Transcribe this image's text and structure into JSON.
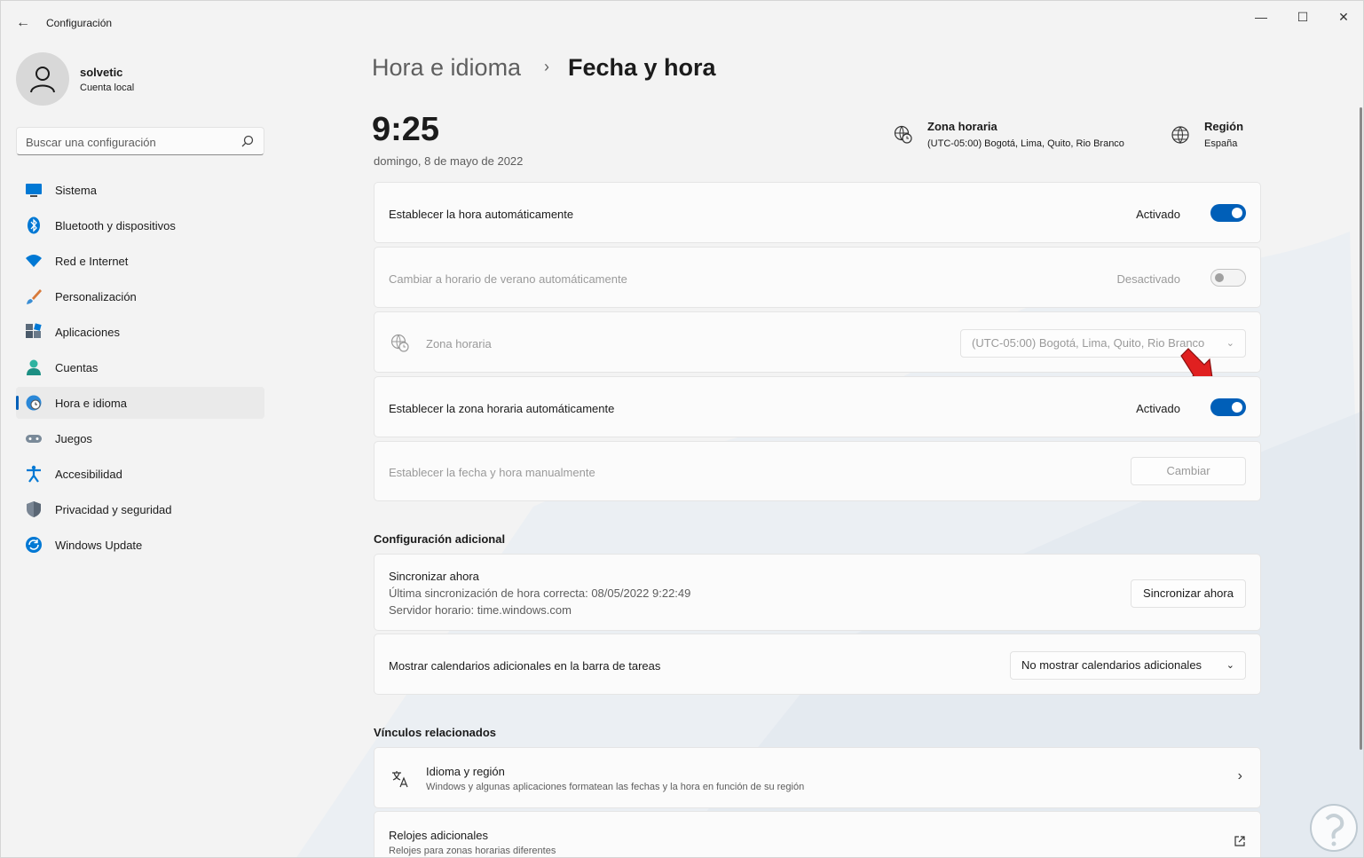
{
  "window": {
    "title": "Configuración",
    "back": "←",
    "minimize": "—",
    "maximize": "☐",
    "close": "✕"
  },
  "user": {
    "name": "solvetic",
    "type": "Cuenta local"
  },
  "search": {
    "placeholder": "Buscar una configuración"
  },
  "nav": [
    {
      "label": "Sistema",
      "icon": "monitor-icon"
    },
    {
      "label": "Bluetooth y dispositivos",
      "icon": "bluetooth-icon"
    },
    {
      "label": "Red e Internet",
      "icon": "wifi-icon"
    },
    {
      "label": "Personalización",
      "icon": "brush-icon"
    },
    {
      "label": "Aplicaciones",
      "icon": "apps-icon"
    },
    {
      "label": "Cuentas",
      "icon": "person-icon"
    },
    {
      "label": "Hora e idioma",
      "icon": "clock-globe-icon",
      "active": true
    },
    {
      "label": "Juegos",
      "icon": "gamepad-icon"
    },
    {
      "label": "Accesibilidad",
      "icon": "accessibility-icon"
    },
    {
      "label": "Privacidad y seguridad",
      "icon": "shield-icon"
    },
    {
      "label": "Windows Update",
      "icon": "update-icon"
    }
  ],
  "breadcrumb": {
    "parent": "Hora e idioma",
    "separator": "›",
    "current": "Fecha y hora"
  },
  "clock": {
    "time": "9:25",
    "date": "domingo, 8 de mayo de 2022"
  },
  "header": {
    "timezone": {
      "title": "Zona horaria",
      "value": "(UTC-05:00) Bogotá, Lima, Quito, Rio Branco"
    },
    "region": {
      "title": "Región",
      "value": "España"
    }
  },
  "settings": {
    "auto_time": {
      "label": "Establecer la hora automáticamente",
      "state": "Activado",
      "on": true
    },
    "dst": {
      "label": "Cambiar a horario de verano automáticamente",
      "state": "Desactivado",
      "on": false
    },
    "timezone": {
      "label": "Zona horaria",
      "value": "(UTC-05:00) Bogotá, Lima, Quito, Rio Branco"
    },
    "auto_timezone": {
      "label": "Establecer la zona horaria automáticamente",
      "state": "Activado",
      "on": true
    },
    "manual": {
      "label": "Establecer la fecha y hora manualmente",
      "button": "Cambiar"
    }
  },
  "additional": {
    "heading": "Configuración adicional",
    "sync": {
      "title": "Sincronizar ahora",
      "last": "Última sincronización de hora correcta: 08/05/2022 9:22:49",
      "server": "Servidor horario: time.windows.com",
      "button": "Sincronizar ahora"
    },
    "calendars": {
      "label": "Mostrar calendarios adicionales en la barra de tareas",
      "value": "No mostrar calendarios adicionales"
    }
  },
  "related": {
    "heading": "Vínculos relacionados",
    "language": {
      "title": "Idioma y región",
      "desc": "Windows y algunas aplicaciones formatean las fechas y la hora en función de su región"
    },
    "clocks": {
      "title": "Relojes adicionales",
      "desc": "Relojes para zonas horarias diferentes"
    }
  },
  "colors": {
    "accent": "#005fb8",
    "arrow": "#e02020"
  }
}
